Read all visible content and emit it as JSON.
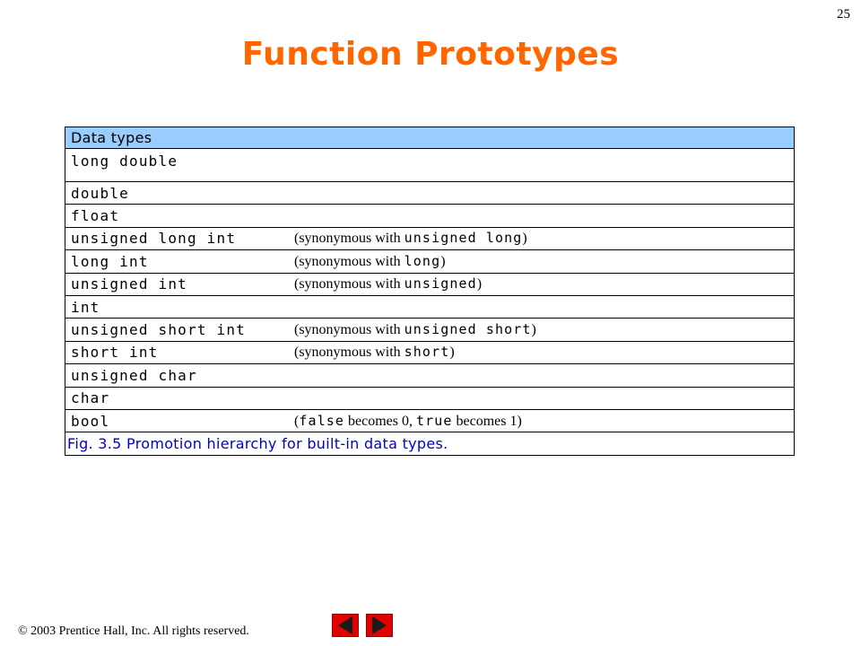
{
  "page_number": "25",
  "title": "Function Prototypes",
  "table": {
    "header": "Data types",
    "rows": [
      {
        "type": "long double",
        "note": null
      },
      {
        "type": "double",
        "note": null
      },
      {
        "type": "float",
        "note": null
      },
      {
        "type": "unsigned long int",
        "note": {
          "prefix": "(synonymous with ",
          "code": "unsigned long",
          "suffix": ")"
        }
      },
      {
        "type": "long int",
        "note": {
          "prefix": "(synonymous with ",
          "code": "long",
          "suffix": ")"
        }
      },
      {
        "type": "unsigned int",
        "note": {
          "prefix": "(synonymous with ",
          "code": "unsigned",
          "suffix": ")"
        }
      },
      {
        "type": "int",
        "note": null
      },
      {
        "type": "unsigned short int",
        "note": {
          "prefix": "(synonymous with ",
          "code": "unsigned short",
          "suffix": ")"
        }
      },
      {
        "type": "short int",
        "note": {
          "prefix": "(synonymous with ",
          "code": "short",
          "suffix": ")"
        }
      },
      {
        "type": "unsigned char",
        "note": null
      },
      {
        "type": "char",
        "note": null
      },
      {
        "type": "bool",
        "note": {
          "open": "(",
          "code1": "false",
          "mid": " becomes 0, ",
          "code2": "true",
          "end": " becomes 1)"
        }
      }
    ],
    "caption": "Fig. 3.5   Promotion hierarchy for built-in data types."
  },
  "footer": {
    "copyright_symbol": "©",
    "copyright_text": " 2003 Prentice Hall, Inc.  All rights reserved."
  },
  "nav": {
    "prev_icon": "left-triangle-icon",
    "next_icon": "right-triangle-icon",
    "color": "#e00000"
  },
  "colors": {
    "title": "#ff6600",
    "header_bg": "#99ccff",
    "caption": "#0000cc"
  }
}
